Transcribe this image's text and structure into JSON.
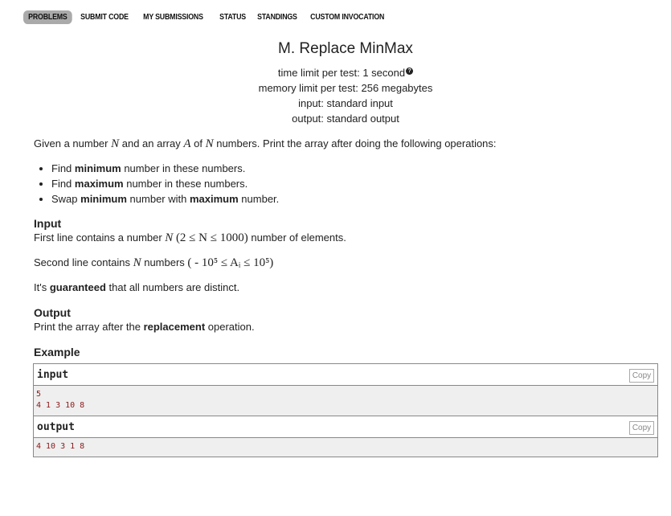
{
  "nav": {
    "items": [
      "Problems",
      "Submit Code",
      "My Submissions",
      "Status",
      "Standings",
      "Custom Invocation"
    ],
    "active": "Problems"
  },
  "problem": {
    "title": "M. Replace MinMax",
    "time_limit": "time limit per test: 1 second",
    "memory_limit": "memory limit per test: 256 megabytes",
    "input": "input: standard input",
    "output": "output: standard output"
  },
  "statement": {
    "intro_1": "Given a number ",
    "var_n": "N",
    "intro_2": " and an array ",
    "var_a": "A",
    "intro_3": " of ",
    "intro_4": " numbers. Print the array after doing the following operations:",
    "bullets": [
      {
        "pre": "Find ",
        "bold": "minimum",
        "post": " number in these numbers."
      },
      {
        "pre": "Find ",
        "bold": "maximum",
        "post": " number in these numbers."
      },
      {
        "pre": "Swap ",
        "bold": "minimum",
        "mid": " number with ",
        "bold2": "maximum",
        "post": " number."
      }
    ]
  },
  "input_section": {
    "title": "Input",
    "line1_pre": "First line contains a number ",
    "line1_math": "(2 ≤ N ≤ 1000)",
    "line1_post": " number of elements.",
    "line2_pre": "Second line contains ",
    "line2_mid": " numbers ",
    "line2_math": "( - 10⁵ ≤ Aᵢ ≤ 10⁵)",
    "line3_pre": "It's ",
    "line3_bold": "guaranteed",
    "line3_post": " that all numbers are distinct."
  },
  "output_section": {
    "title": "Output",
    "pre": "Print the array after the ",
    "bold": "replacement",
    "post": " operation."
  },
  "example": {
    "title": "Example",
    "input_label": "input",
    "output_label": "output",
    "copy_label": "Copy",
    "input_lines": [
      "5",
      "4 1 3 10 8"
    ],
    "output_lines": [
      "4 10 3 1 8"
    ]
  }
}
